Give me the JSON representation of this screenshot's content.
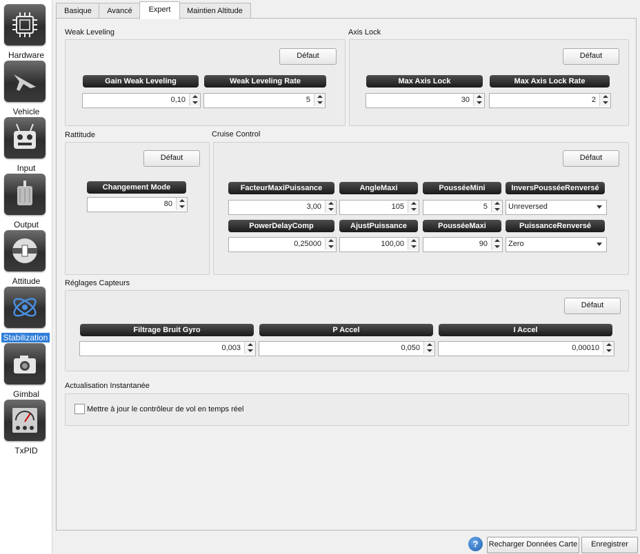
{
  "sidebar": {
    "items": [
      {
        "label": "Hardware",
        "icon": "chip-icon"
      },
      {
        "label": "Vehicle",
        "icon": "aircraft-icon"
      },
      {
        "label": "Input",
        "icon": "transmitter-icon"
      },
      {
        "label": "Output",
        "icon": "motor-icon"
      },
      {
        "label": "Attitude",
        "icon": "level-icon"
      },
      {
        "label": "Stabilization",
        "icon": "gyroscope-icon",
        "active": true
      },
      {
        "label": "Gimbal",
        "icon": "camera-icon"
      },
      {
        "label": "TxPID",
        "icon": "gauge-icon"
      }
    ]
  },
  "tabs": [
    {
      "label": "Basique"
    },
    {
      "label": "Avancé"
    },
    {
      "label": "Expert",
      "active": true
    },
    {
      "label": "Maintien Altitude"
    }
  ],
  "weak_leveling": {
    "title": "Weak Leveling",
    "default_label": "Défaut",
    "fields": [
      {
        "label": "Gain Weak Leveling",
        "value": "0,10"
      },
      {
        "label": "Weak Leveling Rate",
        "value": "5"
      }
    ]
  },
  "axis_lock": {
    "title": "Axis Lock",
    "default_label": "Défaut",
    "fields": [
      {
        "label": "Max Axis Lock",
        "value": "30"
      },
      {
        "label": "Max Axis Lock Rate",
        "value": "2"
      }
    ]
  },
  "rattitude": {
    "title": "Rattitude",
    "default_label": "Défaut",
    "fields": [
      {
        "label": "Changement Mode",
        "value": "80"
      }
    ]
  },
  "cruise_control": {
    "title": "Cruise Control",
    "default_label": "Défaut",
    "fields": [
      {
        "label": "FacteurMaxiPuissance",
        "value": "3,00"
      },
      {
        "label": "AngleMaxi",
        "value": "105"
      },
      {
        "label": "PousséeMini",
        "value": "5"
      },
      {
        "label": "InversPousséeRenversé",
        "value": "Unreversed"
      },
      {
        "label": "PowerDelayComp",
        "value": "0,25000"
      },
      {
        "label": "AjustPuissance",
        "value": "100,00"
      },
      {
        "label": "PousséeMaxi",
        "value": "90"
      },
      {
        "label": "PuissanceRenversé",
        "value": "Zero"
      }
    ]
  },
  "sensors": {
    "title": "Réglages Capteurs",
    "default_label": "Défaut",
    "fields": [
      {
        "label": "Filtrage Bruit Gyro",
        "value": "0,003"
      },
      {
        "label": "P Accel",
        "value": "0,050"
      },
      {
        "label": "I Accel",
        "value": "0,00010"
      }
    ]
  },
  "realtime": {
    "title": "Actualisation Instantanée",
    "checkbox_label": "Mettre à jour le contrôleur de vol en temps réel",
    "checked": false
  },
  "footer": {
    "help_label": "?",
    "reload_label": "Recharger Données Carte",
    "save_label": "Enregistrer"
  }
}
